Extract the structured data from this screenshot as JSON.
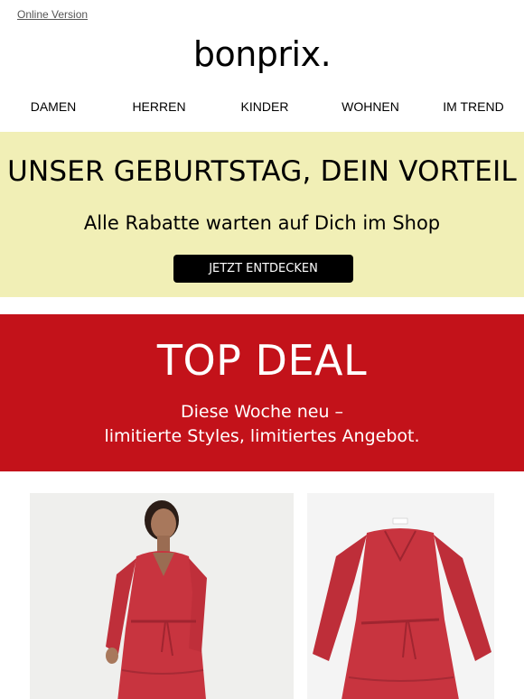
{
  "header": {
    "online_version": "Online Version",
    "logo": "bonprix."
  },
  "nav": {
    "items": [
      {
        "label": "DAMEN"
      },
      {
        "label": "HERREN"
      },
      {
        "label": "KINDER"
      },
      {
        "label": "WOHNEN"
      },
      {
        "label": "IM TREND"
      }
    ]
  },
  "promo": {
    "headline": "UNSER GEBURTSTAG, DEIN VORTEIL",
    "subline": "Alle Rabatte warten auf Dich im Shop",
    "cta_label": "JETZT ENTDECKEN",
    "background": "#f1efb6"
  },
  "deal": {
    "title": "TOP DEAL",
    "line1": "Diese Woche neu –",
    "line2": "limitierte Styles, limitiertes Angebot.",
    "background": "#c3121a"
  },
  "products": [
    {
      "icon": "model-red-dress-image",
      "color": "#c8343f"
    },
    {
      "icon": "red-dress-product-image",
      "color": "#c8343f"
    }
  ]
}
